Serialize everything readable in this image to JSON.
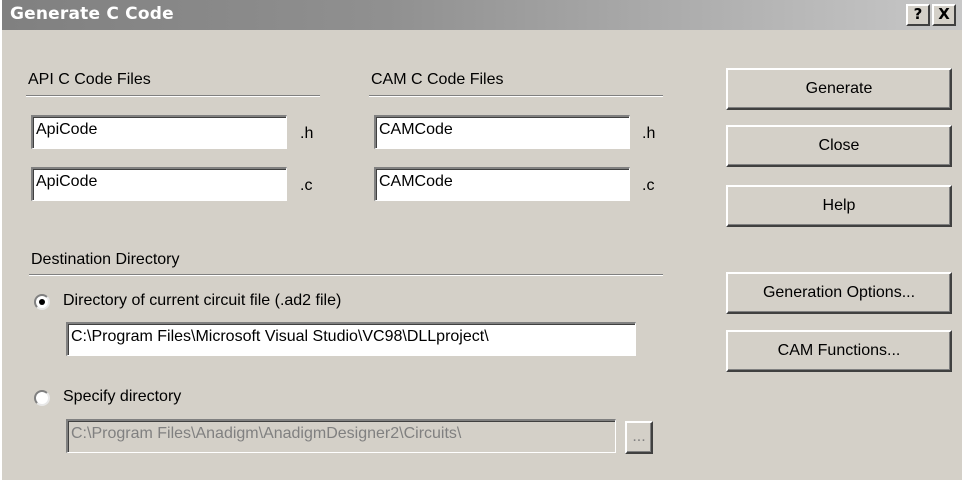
{
  "window": {
    "title": "Generate C Code",
    "help_glyph": "?",
    "close_glyph": "X"
  },
  "api_group": {
    "title": "API C Code Files",
    "header_value": "ApiCode",
    "header_ext": ".h",
    "source_value": "ApiCode",
    "source_ext": ".c"
  },
  "cam_group": {
    "title": "CAM C Code Files",
    "header_value": "CAMCode",
    "header_ext": ".h",
    "source_value": "CAMCode",
    "source_ext": ".c"
  },
  "destination": {
    "title": "Destination Directory",
    "option_current_label": "Directory of current circuit file (.ad2 file)",
    "option_current_selected": true,
    "current_path": "C:\\Program Files\\Microsoft Visual Studio\\VC98\\DLLproject\\",
    "option_specify_label": "Specify directory",
    "option_specify_selected": false,
    "specify_path": "C:\\Program Files\\Anadigm\\AnadigmDesigner2\\Circuits\\",
    "browse_label": "..."
  },
  "buttons": {
    "generate": "Generate",
    "close": "Close",
    "help": "Help",
    "generation_options": "Generation Options...",
    "cam_functions": "CAM Functions..."
  },
  "colors": {
    "face": "#d4d0c8",
    "title_start": "#808080",
    "title_end": "#c8c8c8",
    "disabled_text": "#808080"
  }
}
